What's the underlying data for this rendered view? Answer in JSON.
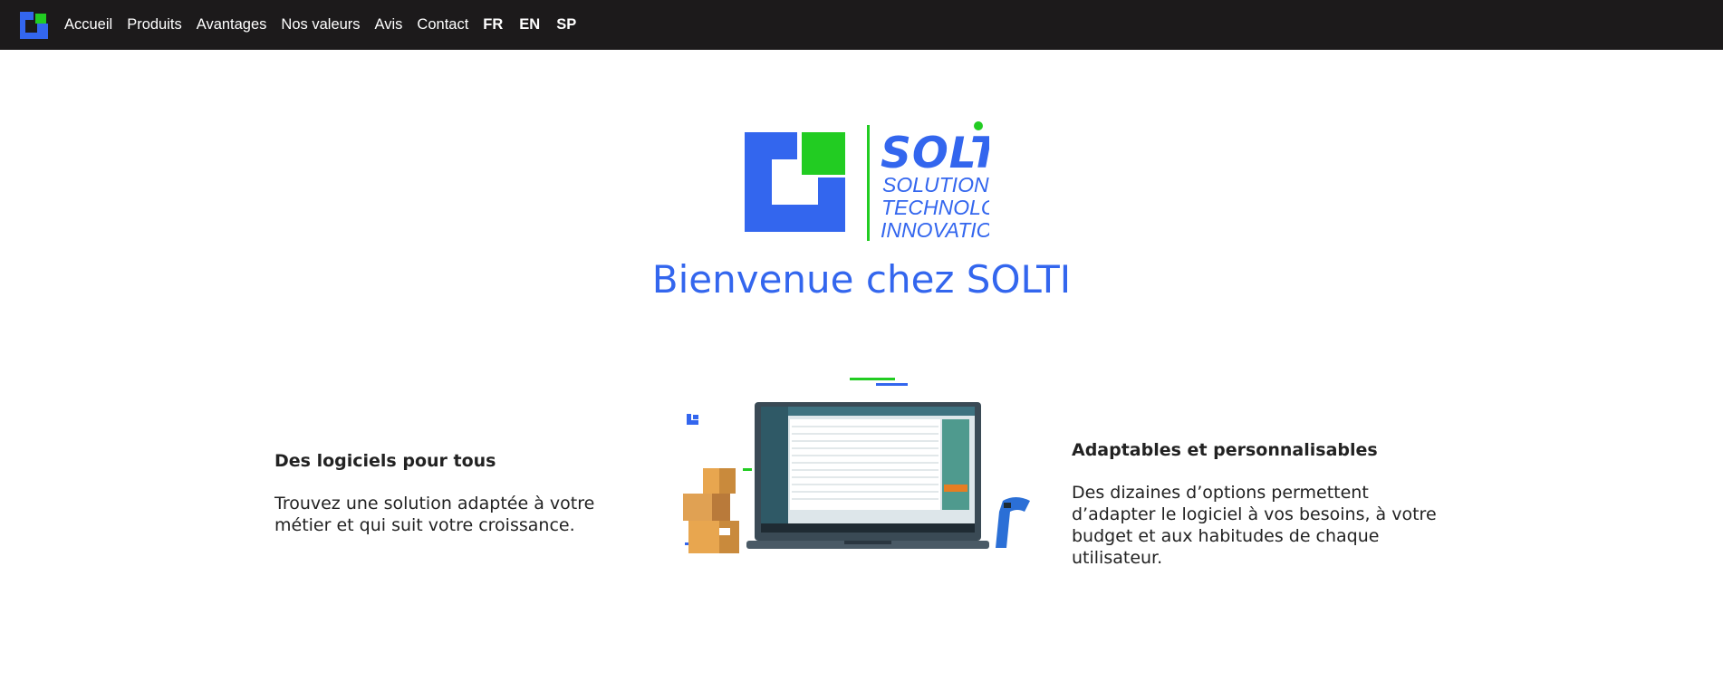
{
  "nav": {
    "logo_icon": "solti-logo-icon",
    "links": [
      "Accueil",
      "Produits",
      "Avantages",
      "Nos valeurs",
      "Avis",
      "Contact"
    ],
    "languages": [
      "FR",
      "EN",
      "SP"
    ]
  },
  "hero": {
    "logo": {
      "brand": "SOLTI",
      "lines": [
        "SOLUTIONS",
        "TECHNOLOGIES",
        "INNOVATIONS"
      ]
    },
    "title": "Bienvenue chez SOLTI"
  },
  "features": {
    "left": {
      "title": "Des logiciels pour tous",
      "text": "Trouvez une solution adaptée à votre métier et qui suit votre croissance."
    },
    "right": {
      "title": "Adaptables et personnalisables",
      "text": "Des dizaines d’options permettent d’adapter le logiciel à vos besoins, à votre budget et aux habitudes de chaque utilisateur."
    }
  },
  "colors": {
    "nav_bg": "#1c1a1b",
    "brand_blue": "#3366ee",
    "brand_green": "#22cc22",
    "text_dark": "#222222"
  }
}
